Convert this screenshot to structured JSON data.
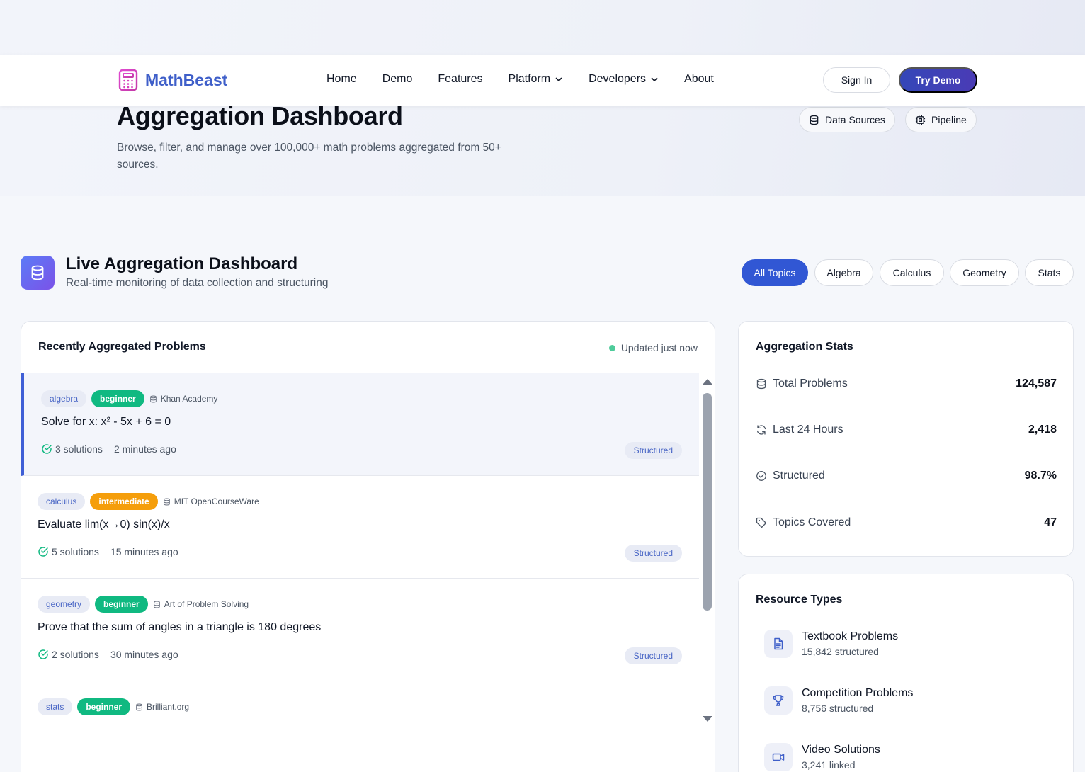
{
  "brand": {
    "name": "MathBeast",
    "color": "#3f5fc9"
  },
  "nav": {
    "links": [
      {
        "label": "Home",
        "dropdown": false
      },
      {
        "label": "Demo",
        "dropdown": false
      },
      {
        "label": "Features",
        "dropdown": false
      },
      {
        "label": "Platform",
        "dropdown": true
      },
      {
        "label": "Developers",
        "dropdown": true
      },
      {
        "label": "About",
        "dropdown": false
      }
    ],
    "sign_in": "Sign In",
    "try_demo": "Try Demo"
  },
  "hero": {
    "title": "Aggregation Dashboard",
    "subtitle": "Browse, filter, and manage over 100,000+ math problems aggregated from 50+ sources.",
    "data_sources": "Data Sources",
    "pipeline": "Pipeline"
  },
  "section": {
    "title": "Live Aggregation Dashboard",
    "subtitle": "Real-time monitoring of data collection and structuring",
    "topics": [
      "All Topics",
      "Algebra",
      "Calculus",
      "Geometry",
      "Stats"
    ],
    "active_topic": "All Topics"
  },
  "problems": {
    "title": "Recently Aggregated Problems",
    "updated": "Updated just now",
    "items": [
      {
        "topic": "algebra",
        "level": "beginner",
        "source": "Khan Academy",
        "question": "Solve for x: x² - 5x + 6 = 0",
        "solutions": "3 solutions",
        "time": "2 minutes ago",
        "status": "Structured"
      },
      {
        "topic": "calculus",
        "level": "intermediate",
        "source": "MIT OpenCourseWare",
        "question": "Evaluate lim(x→0) sin(x)/x",
        "solutions": "5 solutions",
        "time": "15 minutes ago",
        "status": "Structured"
      },
      {
        "topic": "geometry",
        "level": "beginner",
        "source": "Art of Problem Solving",
        "question": "Prove that the sum of angles in a triangle is 180 degrees",
        "solutions": "2 solutions",
        "time": "30 minutes ago",
        "status": "Structured"
      },
      {
        "topic": "stats",
        "level": "beginner",
        "source": "Brilliant.org",
        "question": "",
        "solutions": "",
        "time": "",
        "status": ""
      }
    ]
  },
  "stats": {
    "title": "Aggregation Stats",
    "rows": [
      {
        "label": "Total Problems",
        "value": "124,587",
        "icon": "database-icon"
      },
      {
        "label": "Last 24 Hours",
        "value": "2,418",
        "icon": "refresh-icon"
      },
      {
        "label": "Structured",
        "value": "98.7%",
        "icon": "check-circle-icon"
      },
      {
        "label": "Topics Covered",
        "value": "47",
        "icon": "tag-icon"
      }
    ]
  },
  "resources": {
    "title": "Resource Types",
    "items": [
      {
        "name": "Textbook Problems",
        "count": "15,842 structured",
        "icon": "document-icon"
      },
      {
        "name": "Competition Problems",
        "count": "8,756 structured",
        "icon": "trophy-icon"
      },
      {
        "name": "Video Solutions",
        "count": "3,241 linked",
        "icon": "video-icon"
      }
    ]
  },
  "colors": {
    "primary": "#3157d4",
    "beginner": "#10b981",
    "intermediate": "#f59e0b",
    "tag_bg": "#e8ebf5",
    "tag_text": "#4966c6"
  }
}
